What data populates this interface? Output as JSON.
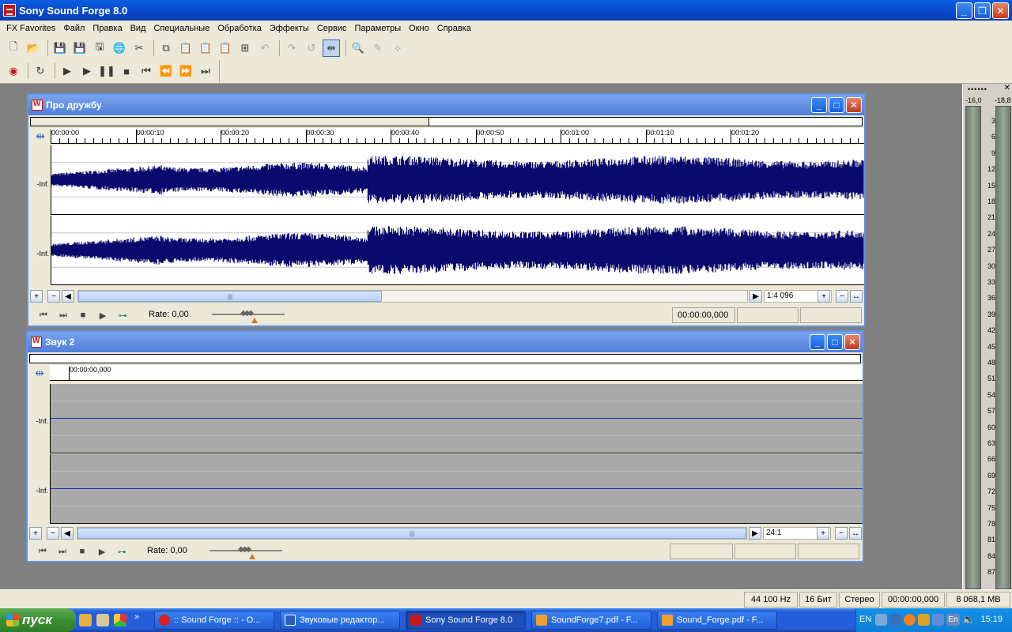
{
  "app": {
    "title": "Sony Sound Forge 8.0"
  },
  "menu": [
    "FX Favorites",
    "Файл",
    "Правка",
    "Вид",
    "Специальные",
    "Обработка",
    "Эффекты",
    "Сервис",
    "Параметры",
    "Окно",
    "Справка"
  ],
  "toolbar1": [
    {
      "name": "new-file-icon",
      "glyph": "🗋",
      "enabled": true
    },
    {
      "name": "open-folder-icon",
      "glyph": "📂",
      "enabled": true
    },
    {
      "name": "save-icon",
      "glyph": "💾",
      "enabled": true
    },
    {
      "name": "save-as-icon",
      "glyph": "💾",
      "enabled": true
    },
    {
      "name": "save-all-icon",
      "glyph": "🖫",
      "enabled": true
    },
    {
      "name": "web-globe-icon",
      "glyph": "🌐",
      "enabled": true
    },
    {
      "name": "cut-icon",
      "glyph": "✂",
      "enabled": true
    },
    {
      "name": "copy-icon",
      "glyph": "⧉",
      "enabled": true
    },
    {
      "name": "paste-icon",
      "glyph": "📋",
      "enabled": true
    },
    {
      "name": "mix-icon",
      "glyph": "📋",
      "enabled": true
    },
    {
      "name": "paste-special-icon",
      "glyph": "📋",
      "enabled": true
    },
    {
      "name": "trim-icon",
      "glyph": "⊞",
      "enabled": true
    },
    {
      "name": "undo-icon",
      "glyph": "↶",
      "enabled": false
    },
    {
      "name": "redo-icon",
      "glyph": "↷",
      "enabled": false
    },
    {
      "name": "repeat-icon",
      "glyph": "↺",
      "enabled": false
    },
    {
      "name": "edit-tool-icon",
      "glyph": "⇹",
      "enabled": true,
      "pressed": true
    },
    {
      "name": "magnify-tool-icon",
      "glyph": "🔍",
      "enabled": true
    },
    {
      "name": "pencil-tool-icon",
      "glyph": "✎",
      "enabled": false
    },
    {
      "name": "envelope-tool-icon",
      "glyph": "⟡",
      "enabled": false
    }
  ],
  "toolbar2": [
    {
      "name": "record-icon",
      "glyph": "◉"
    },
    {
      "name": "loop-icon",
      "glyph": "↻"
    },
    {
      "name": "play-all-icon",
      "glyph": "▶"
    },
    {
      "name": "play-icon",
      "glyph": "▶"
    },
    {
      "name": "pause-icon",
      "glyph": "❚❚"
    },
    {
      "name": "stop-icon",
      "glyph": "■"
    },
    {
      "name": "go-to-start-icon",
      "glyph": "⏮"
    },
    {
      "name": "rewind-icon",
      "glyph": "⏪"
    },
    {
      "name": "forward-icon",
      "glyph": "⏩"
    },
    {
      "name": "go-to-end-icon",
      "glyph": "⏭"
    }
  ],
  "meter": {
    "top": "••••••",
    "left_head": "-16,0",
    "right_head": "-18,8",
    "scale": [
      "3",
      "6",
      "9",
      "12",
      "15",
      "18",
      "21",
      "24",
      "27",
      "30",
      "33",
      "36",
      "39",
      "42",
      "45",
      "48",
      "51",
      "54",
      "57",
      "60",
      "63",
      "66",
      "69",
      "72",
      "75",
      "78",
      "81",
      "84",
      "87"
    ]
  },
  "win1": {
    "title": "Про дружбу",
    "overview_fraction": 0.48,
    "ruler": [
      "00:00:00",
      "00:00:10",
      "00:00:20",
      "00:00:30",
      "00:00:40",
      "00:00:50",
      "00:01:00",
      "00:01:10",
      "00:01:20"
    ],
    "ch_label": "-Inf.",
    "zoom": "1:4 096",
    "rate": "Rate: 0,00",
    "time": "00:00:00,000",
    "wave_color": "#0a0a6e"
  },
  "win2": {
    "title": "Звук 2",
    "ruler": [
      "00:00:00,000"
    ],
    "ch_label": "-Inf.",
    "zoom": "24:1",
    "rate": "Rate: 0,00",
    "line_color": "#2030b0"
  },
  "status": {
    "rate": "44 100 Hz",
    "bits": "16 Бит",
    "channels": "Стерео",
    "time": "00:00:00,000",
    "memory": "8 068,1 MB"
  },
  "taskbar": {
    "start": "пуск",
    "tasks": [
      {
        "label": ":: Sound Forge :: - O...",
        "color": "#d81e1e"
      },
      {
        "label": "Звуковые редактор...",
        "color": "#2b5cbf"
      },
      {
        "label": "Sony Sound Forge 8.0",
        "color": "#c81818",
        "active": true
      },
      {
        "label": "SoundForge7.pdf - F...",
        "color": "#f0a030"
      },
      {
        "label": "Sound_Forge.pdf - F...",
        "color": "#f0a030"
      }
    ],
    "lang": "EN",
    "lang2": "En",
    "clock": "15:19"
  }
}
